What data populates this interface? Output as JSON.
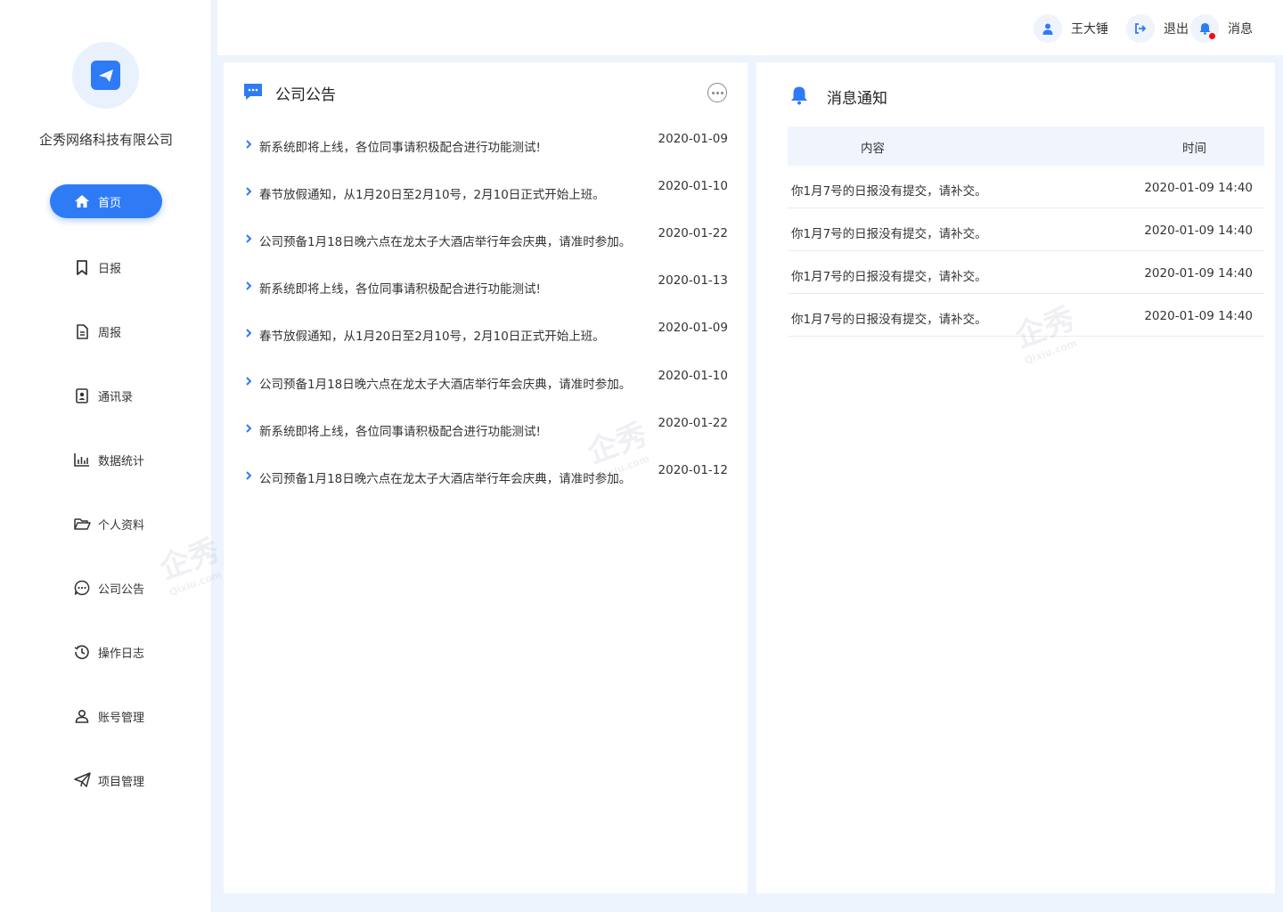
{
  "brand": {
    "company_name": "企秀网络科技有限公司",
    "accent_color": "#2f7bf6"
  },
  "sidebar": {
    "items": [
      {
        "label": "首页",
        "icon": "home-icon",
        "active": true
      },
      {
        "label": "日报",
        "icon": "bookmark-icon",
        "active": false
      },
      {
        "label": "周报",
        "icon": "document-icon",
        "active": false
      },
      {
        "label": "通讯录",
        "icon": "contacts-icon",
        "active": false
      },
      {
        "label": "数据统计",
        "icon": "bar-chart-icon",
        "active": false
      },
      {
        "label": "个人资料",
        "icon": "folder-icon",
        "active": false
      },
      {
        "label": "公司公告",
        "icon": "chat-bubble-icon",
        "active": false
      },
      {
        "label": "操作日志",
        "icon": "history-icon",
        "active": false
      },
      {
        "label": "账号管理",
        "icon": "user-icon",
        "active": false
      },
      {
        "label": "项目管理",
        "icon": "paper-plane-icon",
        "active": false
      }
    ]
  },
  "header": {
    "user_name": "王大锤",
    "logout_label": "退出",
    "messages_label": "消息"
  },
  "announcements": {
    "title": "公司公告",
    "items": [
      {
        "text": "新系统即将上线，各位同事请积极配合进行功能测试!",
        "date": "2020-01-09"
      },
      {
        "text": "春节放假通知，从1月20日至2月10号，2月10日正式开始上班。",
        "date": "2020-01-10"
      },
      {
        "text": "公司预备1月18日晚六点在龙太子大酒店举行年会庆典，请准时参加。",
        "date": "2020-01-22"
      },
      {
        "text": "新系统即将上线，各位同事请积极配合进行功能测试!",
        "date": "2020-01-13"
      },
      {
        "text": "春节放假通知，从1月20日至2月10号，2月10日正式开始上班。",
        "date": "2020-01-09"
      },
      {
        "text": "公司预备1月18日晚六点在龙太子大酒店举行年会庆典，请准时参加。",
        "date": "2020-01-10"
      },
      {
        "text": "新系统即将上线，各位同事请积极配合进行功能测试!",
        "date": "2020-01-22"
      },
      {
        "text": "公司预备1月18日晚六点在龙太子大酒店举行年会庆典，请准时参加。",
        "date": "2020-01-12"
      }
    ]
  },
  "notifications": {
    "title": "消息通知",
    "columns": [
      "内容",
      "时间"
    ],
    "rows": [
      {
        "content": "你1月7号的日报没有提交，请补交。",
        "time": "2020-01-09 14:40"
      },
      {
        "content": "你1月7号的日报没有提交，请补交。",
        "time": "2020-01-09 14:40"
      },
      {
        "content": "你1月7号的日报没有提交，请补交。",
        "time": "2020-01-09 14:40"
      },
      {
        "content": "你1月7号的日报没有提交，请补交。",
        "time": "2020-01-09 14:40"
      }
    ]
  },
  "watermark": {
    "text": "企秀",
    "subtext": "Qixiu.com"
  }
}
